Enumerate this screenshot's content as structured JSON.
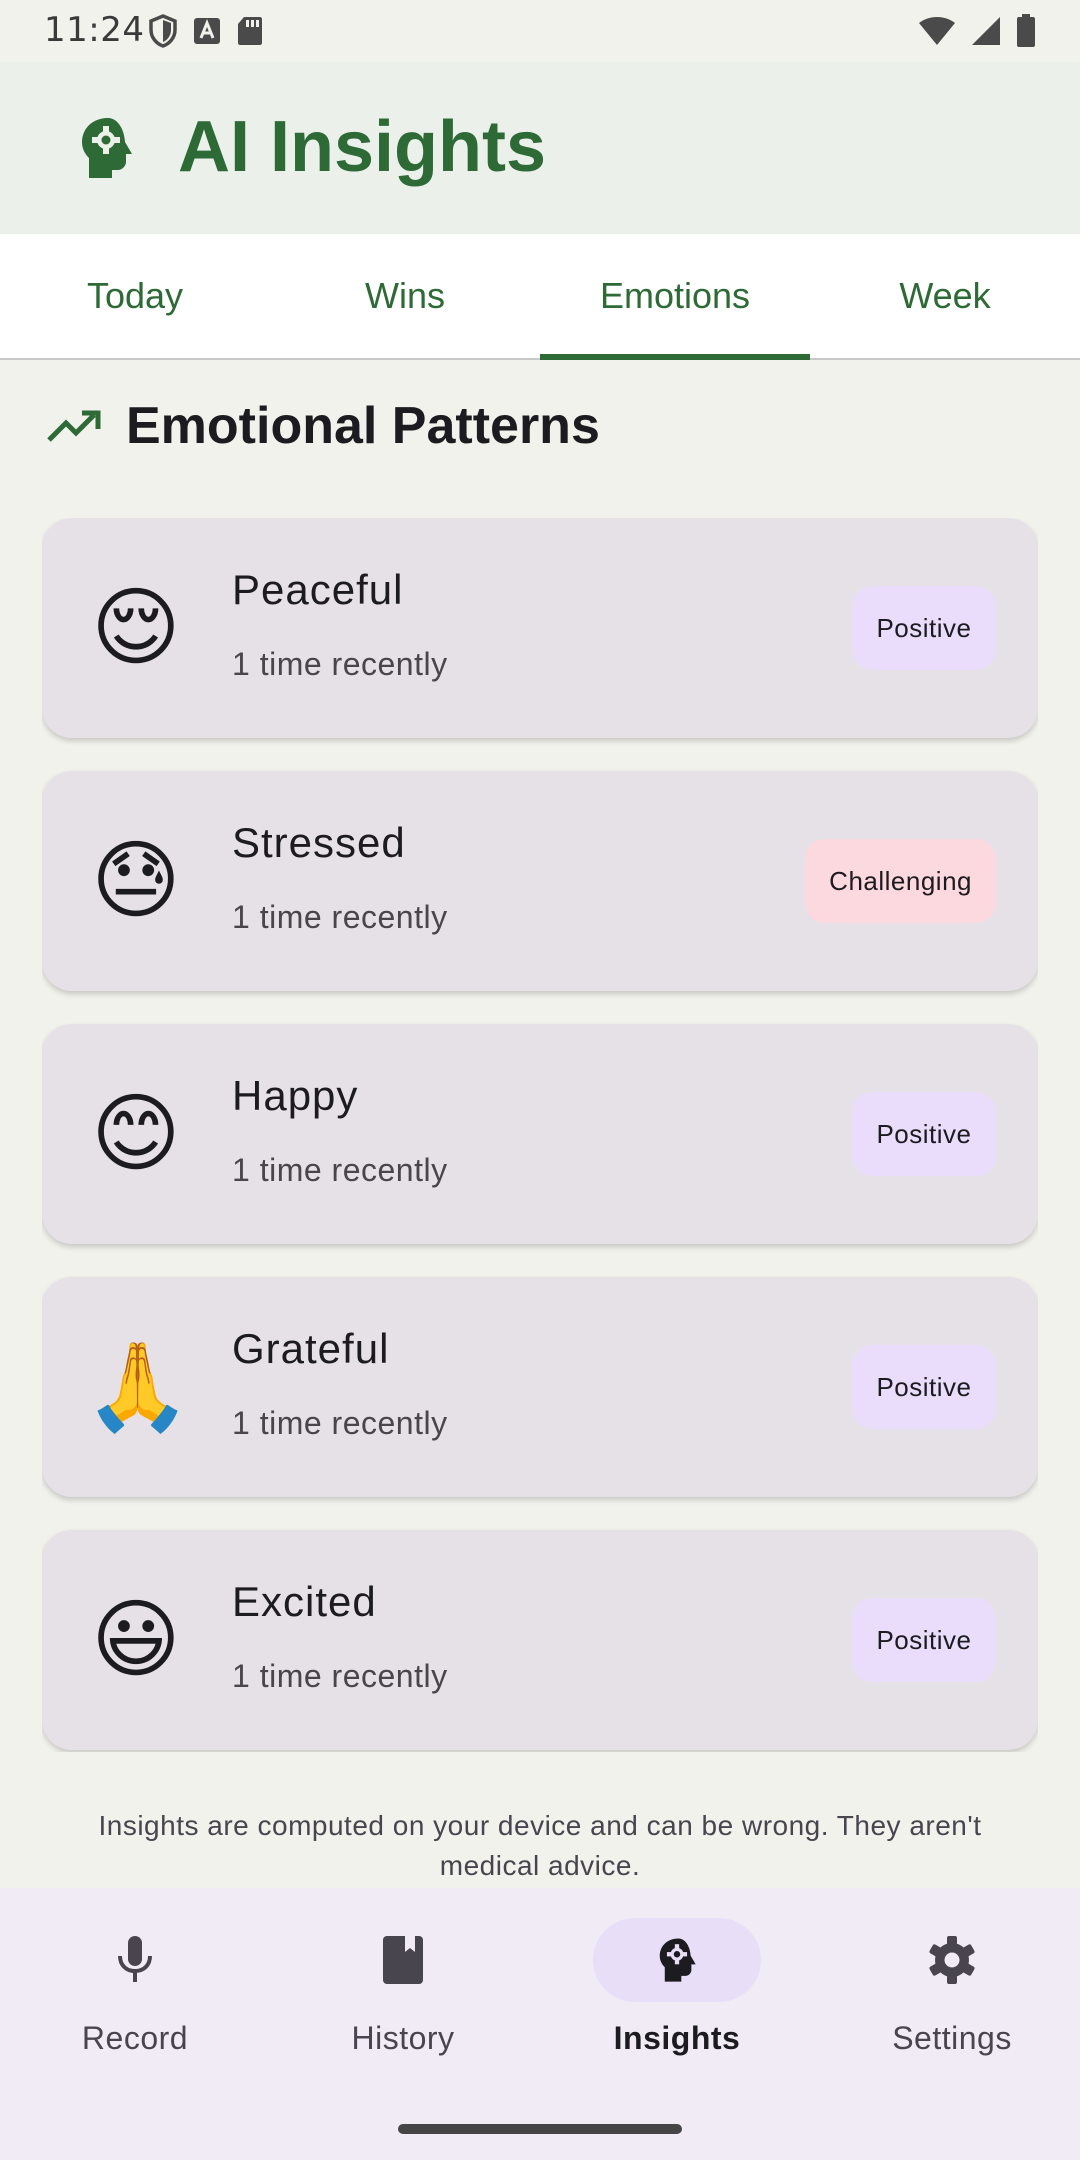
{
  "status_bar": {
    "time": "11:24",
    "left_icons": [
      "shield-icon",
      "a-badge-icon",
      "sd-card-icon"
    ],
    "right_icons": [
      "wifi-icon",
      "signal-icon",
      "battery-icon"
    ]
  },
  "header": {
    "title": "AI Insights",
    "icon": "head-gear-icon",
    "accent_color": "#2d6a36"
  },
  "tabs": [
    {
      "label": "Today",
      "active": false
    },
    {
      "label": "Wins",
      "active": false
    },
    {
      "label": "Emotions",
      "active": true
    },
    {
      "label": "Week",
      "active": false
    }
  ],
  "section": {
    "title": "Emotional Patterns",
    "icon": "trending-up-icon"
  },
  "emotions": [
    {
      "emoji": "😌",
      "name": "Peaceful",
      "count": "1 time recently",
      "badge": "Positive",
      "badge_type": "positive"
    },
    {
      "emoji": "😓",
      "name": "Stressed",
      "count": "1 time recently",
      "badge": "Challenging",
      "badge_type": "challenging"
    },
    {
      "emoji": "😊",
      "name": "Happy",
      "count": "1 time recently",
      "badge": "Positive",
      "badge_type": "positive"
    },
    {
      "emoji": "🙏",
      "name": "Grateful",
      "count": "1 time recently",
      "badge": "Positive",
      "badge_type": "positive"
    },
    {
      "emoji": "😃",
      "name": "Excited",
      "count": "1 time recently",
      "badge": "Positive",
      "badge_type": "positive"
    }
  ],
  "disclaimer": "Insights are computed on your device and can be wrong. They aren't medical advice.",
  "bottom_nav": [
    {
      "label": "Record",
      "icon": "mic-icon",
      "active": false
    },
    {
      "label": "History",
      "icon": "book-icon",
      "active": false
    },
    {
      "label": "Insights",
      "icon": "head-gear-icon",
      "active": true
    },
    {
      "label": "Settings",
      "icon": "gear-icon",
      "active": false
    }
  ],
  "colors": {
    "positive_badge": "#eaddfb",
    "challenging_badge": "#fcd8df",
    "card_bg": "#e6e1e6"
  }
}
